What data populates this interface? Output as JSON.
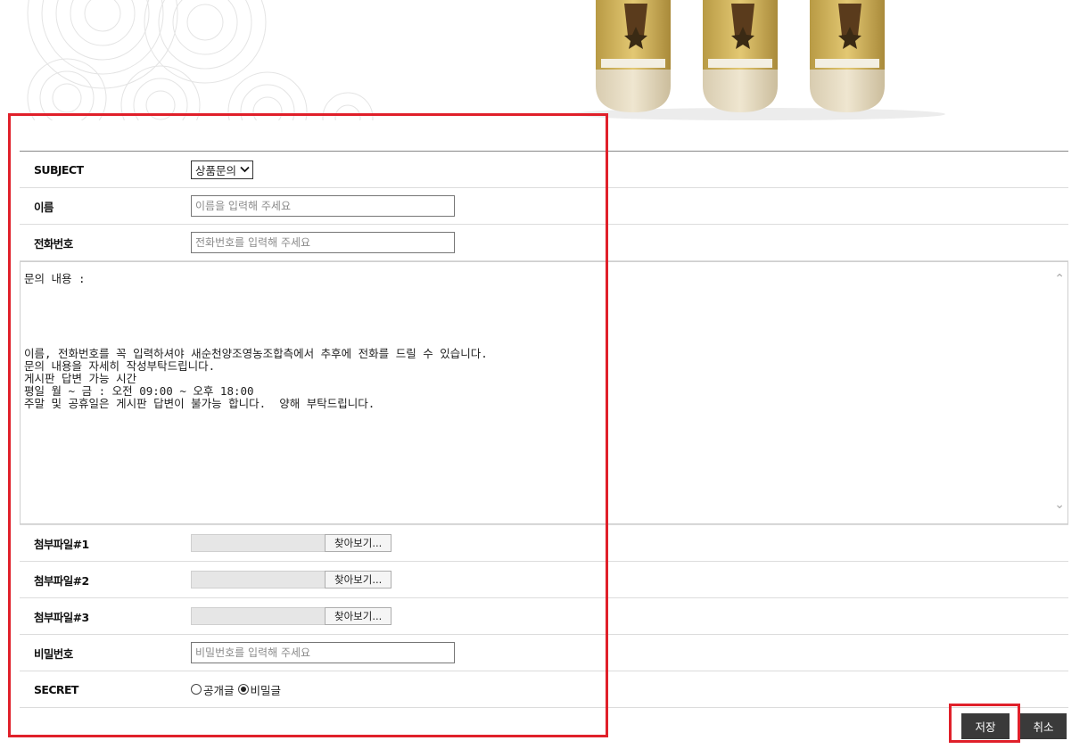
{
  "form": {
    "subject": {
      "label": "SUBJECT",
      "selected": "상품문의"
    },
    "name": {
      "label": "이름",
      "placeholder": "이름을 입력해 주세요"
    },
    "phone": {
      "label": "전화번호",
      "placeholder": "전화번호를 입력해 주세요"
    },
    "content": {
      "text": "문의 내용 :\n\n\n\n\n\n이름, 전화번호를 꼭 입력하셔야 새순천양조영농조합측에서 추후에 전화를 드릴 수 있습니다.\n문의 내용을 자세히 작성부탁드립니다.\n게시판 답변 가능 시간\n평일 월 ~ 금 : 오전 09:00 ~ 오후 18:00\n주말 및 공휴일은 게시판 답변이 불가능 합니다.  양해 부탁드립니다."
    },
    "attachments": [
      {
        "label": "첨부파일#1",
        "button": "찾아보기..."
      },
      {
        "label": "첨부파일#2",
        "button": "찾아보기..."
      },
      {
        "label": "첨부파일#3",
        "button": "찾아보기..."
      }
    ],
    "password": {
      "label": "비밀번호",
      "placeholder": "비밀번호를 입력해 주세요"
    },
    "secret": {
      "label": "SECRET",
      "options": [
        "공개글",
        "비밀글"
      ],
      "selected": "비밀글"
    }
  },
  "actions": {
    "save": "저장",
    "cancel": "취소"
  },
  "colors": {
    "highlight": "#e0202a",
    "button_bg": "#3a3a3a"
  }
}
